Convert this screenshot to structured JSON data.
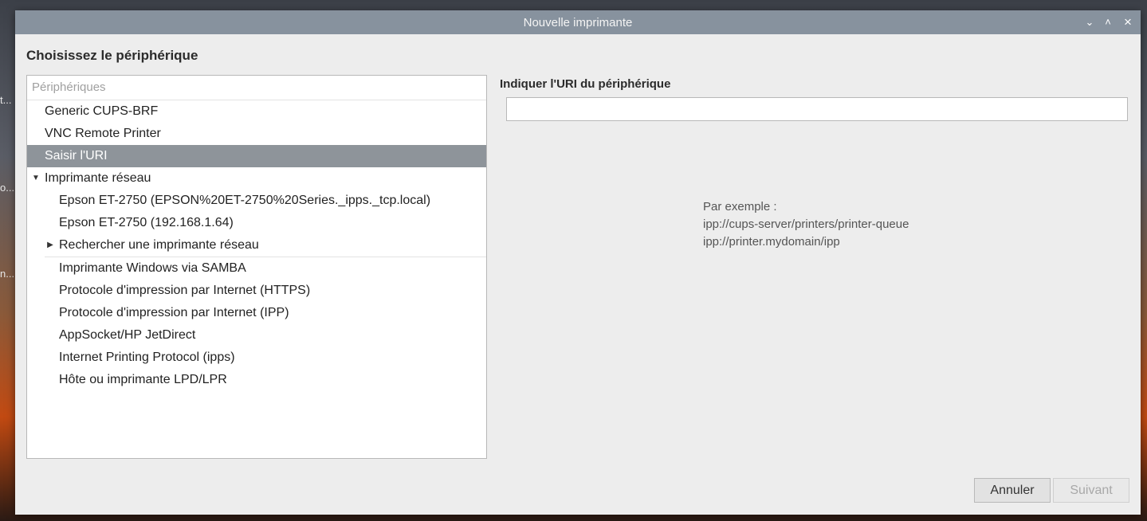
{
  "window": {
    "title": "Nouvelle imprimante"
  },
  "window_controls": {
    "minimize": "⌄",
    "maximize": "˄",
    "close": "×"
  },
  "heading": "Choisissez le périphérique",
  "desktop_fragments": [
    "t...",
    "o...",
    "n..."
  ],
  "device_list": {
    "header": "Périphériques",
    "items_top": [
      "Generic CUPS-BRF",
      "VNC Remote Printer",
      "Saisir l'URI"
    ],
    "network_group": {
      "label": "Imprimante réseau",
      "children": [
        "Epson ET-2750 (EPSON%20ET-2750%20Series._ipps._tcp.local)",
        "Epson ET-2750 (192.168.1.64)"
      ],
      "search": "Rechercher une imprimante réseau"
    },
    "items_bottom": [
      "Imprimante Windows via SAMBA",
      "Protocole d'impression par Internet (HTTPS)",
      "Protocole d'impression par Internet (IPP)",
      "AppSocket/HP JetDirect",
      "Internet Printing Protocol (ipps)",
      "Hôte ou imprimante LPD/LPR"
    ]
  },
  "uri": {
    "label": "Indiquer l'URI du périphérique",
    "value": "",
    "example_title": "Par exemple :",
    "example_1": "ipp://cups-server/printers/printer-queue",
    "example_2": "ipp://printer.mydomain/ipp"
  },
  "buttons": {
    "cancel": "Annuler",
    "next": "Suivant"
  }
}
